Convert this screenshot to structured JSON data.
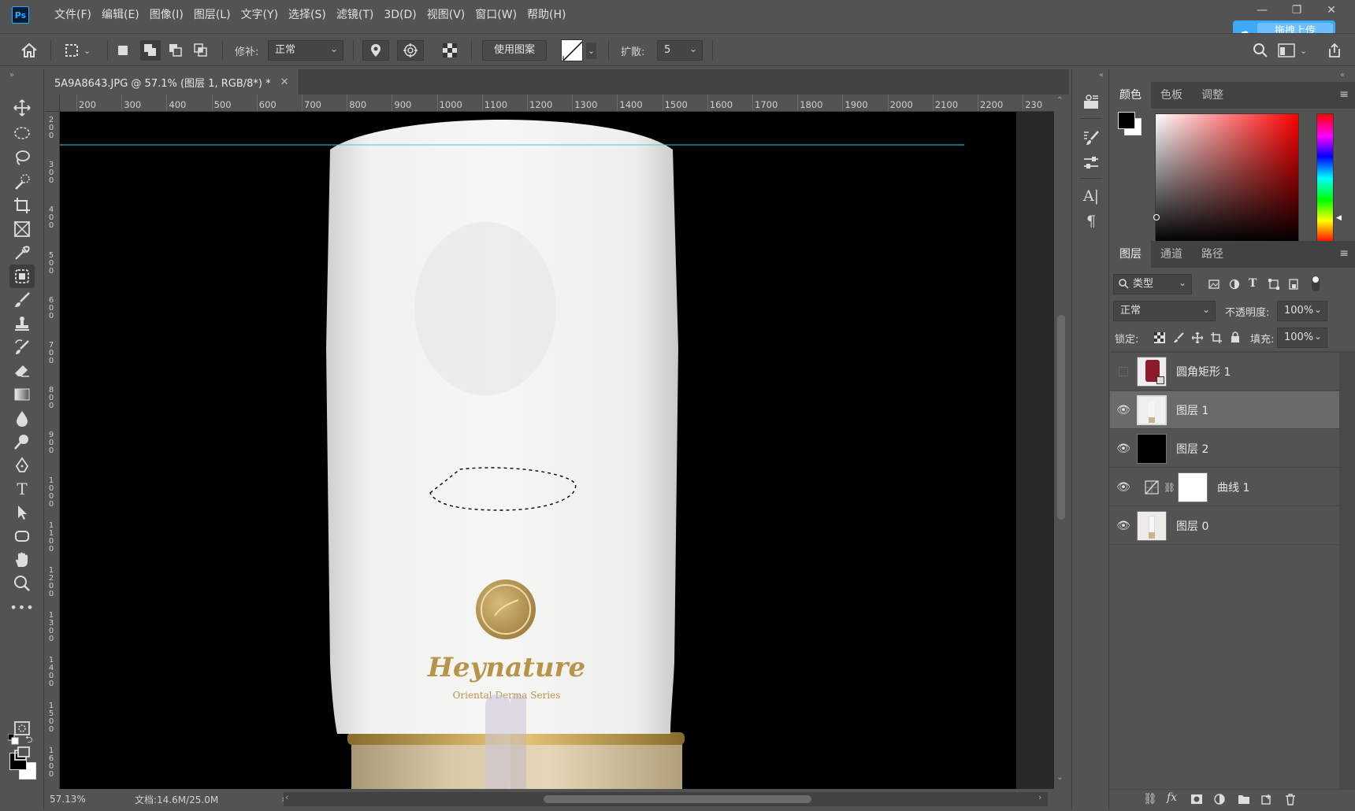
{
  "app": {
    "logo": "Ps",
    "menu": [
      "文件(F)",
      "编辑(E)",
      "图像(I)",
      "图层(L)",
      "文字(Y)",
      "选择(S)",
      "滤镜(T)",
      "3D(D)",
      "视图(V)",
      "窗口(W)",
      "帮助(H)"
    ],
    "upload_badge": "拖拽上传"
  },
  "options": {
    "patch_label": "修补:",
    "patch_value": "正常",
    "use_pattern": "使用图案",
    "diffuse_label": "扩散:",
    "diffuse_value": "5"
  },
  "document": {
    "tab_title": "5A9A8643.JPG @ 57.1% (图层 1, RGB/8*) *",
    "ruler_top": [
      "200",
      "300",
      "400",
      "500",
      "600",
      "700",
      "800",
      "900",
      "1000",
      "1100",
      "1200",
      "1300",
      "1400",
      "1500",
      "1600",
      "1700",
      "1800",
      "1900",
      "2000",
      "2100",
      "2200",
      "230"
    ],
    "ruler_left": [
      [
        "2",
        "0",
        "0"
      ],
      [
        "3",
        "0",
        "0"
      ],
      [
        "4",
        "0",
        "0"
      ],
      [
        "5",
        "0",
        "0"
      ],
      [
        "6",
        "0",
        "0"
      ],
      [
        "7",
        "0",
        "0"
      ],
      [
        "8",
        "0",
        "0"
      ],
      [
        "9",
        "0",
        "0"
      ],
      [
        "1",
        "0",
        "0",
        "0"
      ],
      [
        "1",
        "1",
        "0",
        "0"
      ],
      [
        "1",
        "2",
        "0",
        "0"
      ],
      [
        "1",
        "3",
        "0",
        "0"
      ],
      [
        "1",
        "4",
        "0",
        "0"
      ],
      [
        "1",
        "5",
        "0",
        "0"
      ],
      [
        "1",
        "6",
        "0",
        "0"
      ]
    ],
    "product_brand": "Heynature",
    "product_series": "Oriental Derma Series",
    "status_zoom": "57.13%",
    "status_doc": "文档:14.6M/25.0M"
  },
  "color_panel": {
    "tabs": [
      "颜色",
      "色板",
      "调整"
    ]
  },
  "layers_panel": {
    "tabs": [
      "图层",
      "通道",
      "路径"
    ],
    "filter_label": "类型",
    "blend_mode": "正常",
    "opacity_label": "不透明度:",
    "opacity_value": "100%",
    "lock_label": "锁定:",
    "fill_label": "填充:",
    "fill_value": "100%",
    "layers": [
      {
        "name": "圆角矩形 1",
        "visible": false,
        "selected": false
      },
      {
        "name": "图层 1",
        "visible": true,
        "selected": true
      },
      {
        "name": "图层 2",
        "visible": true,
        "selected": false
      },
      {
        "name": "曲线 1",
        "visible": true,
        "selected": false
      },
      {
        "name": "图层 0",
        "visible": true,
        "selected": false
      }
    ]
  },
  "colors": {
    "guide": "#3fd0e0",
    "accent_blue": "#3da8f5"
  }
}
